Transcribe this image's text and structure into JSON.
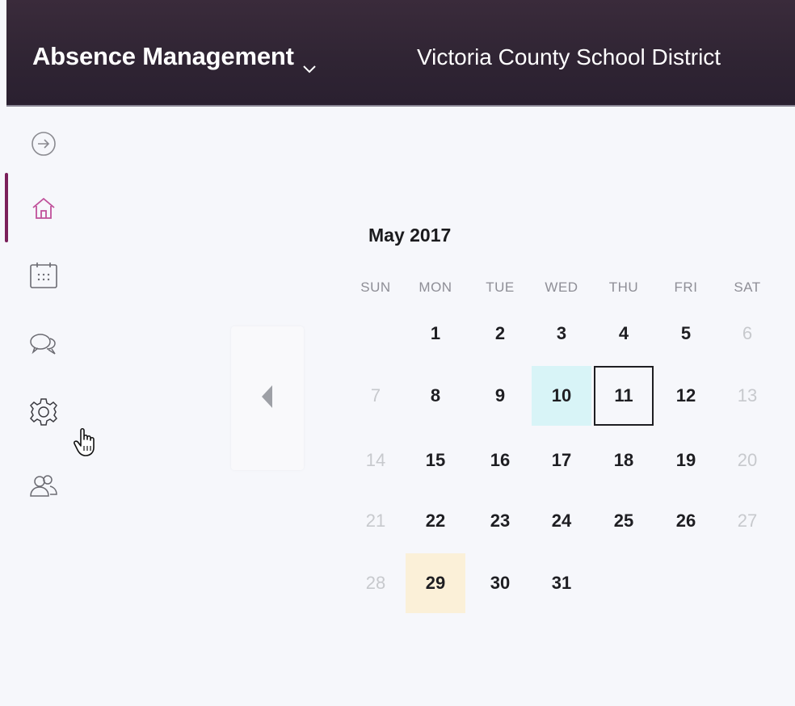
{
  "header": {
    "app_title": "Absence Management",
    "org_name": "Victoria County School District"
  },
  "sidebar": {
    "items": [
      {
        "icon": "arrow-right-circle-icon",
        "active": false
      },
      {
        "icon": "home-icon",
        "active": true
      },
      {
        "icon": "calendar-icon",
        "active": false
      },
      {
        "icon": "chat-bubbles-icon",
        "active": false
      },
      {
        "icon": "gear-icon",
        "active": false
      },
      {
        "icon": "users-icon",
        "active": false
      }
    ]
  },
  "calendar": {
    "month_label": "May 2017",
    "weekdays": [
      "SUN",
      "MON",
      "TUE",
      "WED",
      "THU",
      "FRI",
      "SAT"
    ],
    "weeks": [
      [
        "",
        "1",
        "2",
        "3",
        "4",
        "5",
        "6"
      ],
      [
        "7",
        "8",
        "9",
        "10",
        "11",
        "12",
        "13"
      ],
      [
        "14",
        "15",
        "16",
        "17",
        "18",
        "19",
        "20"
      ],
      [
        "21",
        "22",
        "23",
        "24",
        "25",
        "26",
        "27"
      ],
      [
        "28",
        "29",
        "30",
        "31",
        "",
        "",
        ""
      ]
    ],
    "selected_day": "11",
    "highlighted_days": [
      {
        "day": "10",
        "color": "#d8f4f7"
      },
      {
        "day": "29",
        "color": "#fbf0d8"
      }
    ]
  },
  "colors": {
    "header_bg": "#2f2433",
    "accent": "#7a1f5a",
    "muted_day": "#c7c9cd"
  }
}
